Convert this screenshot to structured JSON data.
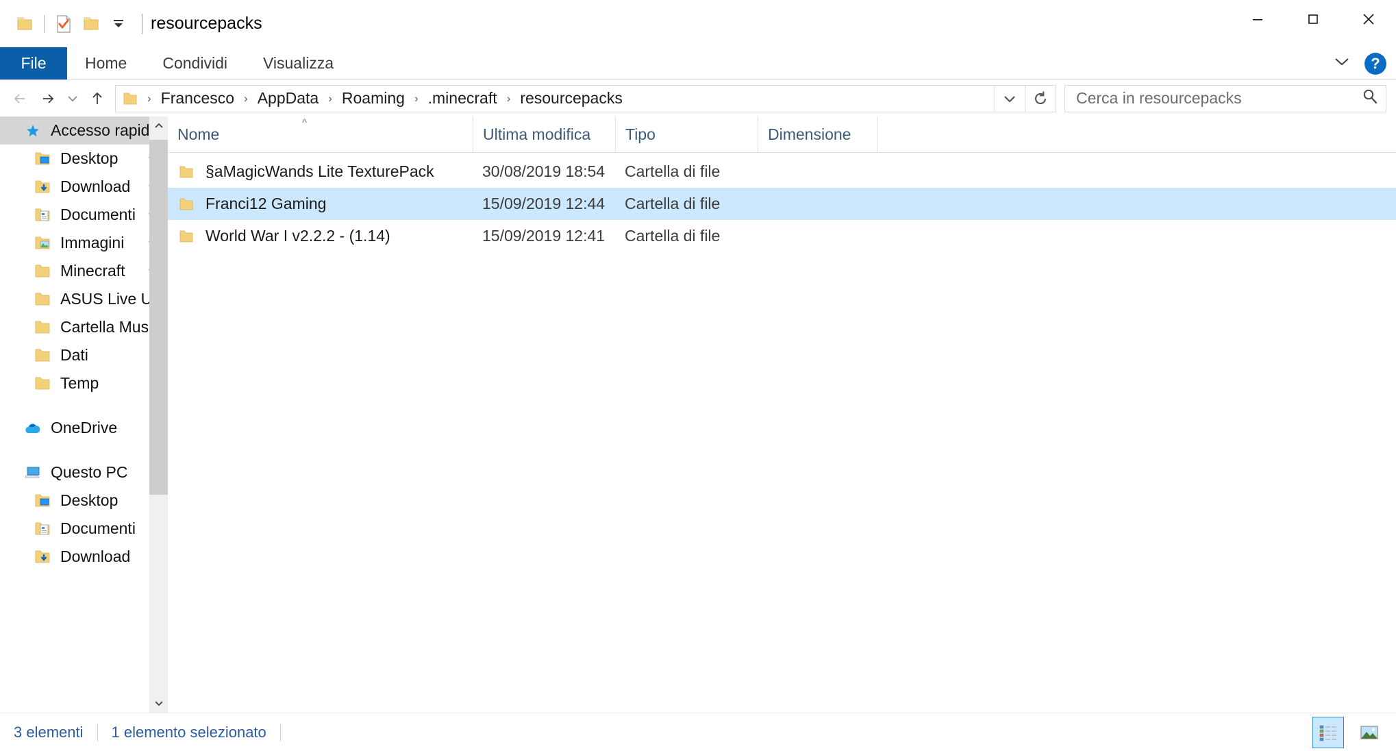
{
  "window": {
    "title": "resourcepacks",
    "quick_access_toolbar": [
      {
        "name": "folder-icon",
        "label": "Cartella"
      },
      {
        "name": "properties-icon",
        "label": "Proprietà"
      },
      {
        "name": "new-folder-icon",
        "label": "Nuova cartella"
      },
      {
        "name": "customize-dropdown-icon",
        "label": "Personalizza barra di accesso rapido"
      }
    ],
    "controls": {
      "minimize": "Riduci a icona",
      "maximize": "Ingrandisci",
      "close": "Chiudi"
    }
  },
  "ribbon": {
    "tabs": [
      {
        "label": "File",
        "active": true
      },
      {
        "label": "Home",
        "active": false
      },
      {
        "label": "Condividi",
        "active": false
      },
      {
        "label": "Visualizza",
        "active": false
      }
    ],
    "expand_label": "Espandi barra multifunzione",
    "help_label": "?"
  },
  "addressbar": {
    "back": "Indietro",
    "forward": "Avanti",
    "recent": "Percorsi recenti",
    "up": "Su",
    "breadcrumbs": [
      "Francesco",
      "AppData",
      "Roaming",
      ".minecraft",
      "resourcepacks"
    ],
    "separator": "›",
    "dropdown": "Elenco percorsi",
    "refresh": "Aggiorna"
  },
  "search": {
    "placeholder": "Cerca in resourcepacks",
    "value": "",
    "icon": "search-icon"
  },
  "sidebar": {
    "groups": [
      {
        "header": {
          "label": "Accesso rapido",
          "icon": "pin-star-icon",
          "selected": true
        },
        "items": [
          {
            "label": "Desktop",
            "icon": "folder-desktop-icon",
            "pinned": true
          },
          {
            "label": "Download",
            "icon": "folder-download-icon",
            "pinned": true
          },
          {
            "label": "Documenti",
            "icon": "folder-documents-icon",
            "pinned": true
          },
          {
            "label": "Immagini",
            "icon": "folder-pictures-icon",
            "pinned": true
          },
          {
            "label": "Minecraft",
            "icon": "folder-icon",
            "pinned": true
          },
          {
            "label": "ASUS Live Updat",
            "icon": "folder-icon",
            "pinned": false
          },
          {
            "label": "Cartella Musica",
            "icon": "folder-icon",
            "pinned": false
          },
          {
            "label": "Dati",
            "icon": "folder-icon",
            "pinned": false
          },
          {
            "label": "Temp",
            "icon": "folder-icon",
            "pinned": false
          }
        ]
      },
      {
        "header": {
          "label": "OneDrive",
          "icon": "onedrive-cloud-icon",
          "selected": false
        },
        "items": []
      },
      {
        "header": {
          "label": "Questo PC",
          "icon": "this-pc-icon",
          "selected": false
        },
        "items": [
          {
            "label": "Desktop",
            "icon": "folder-desktop-icon",
            "pinned": false
          },
          {
            "label": "Documenti",
            "icon": "folder-documents-icon",
            "pinned": false
          },
          {
            "label": "Download",
            "icon": "folder-download-icon",
            "pinned": false
          }
        ]
      }
    ]
  },
  "filelist": {
    "columns": [
      {
        "label": "Nome",
        "sorted": true,
        "sort_direction": "asc"
      },
      {
        "label": "Ultima modifica",
        "sorted": false
      },
      {
        "label": "Tipo",
        "sorted": false
      },
      {
        "label": "Dimensione",
        "sorted": false
      }
    ],
    "sort_glyph": "^",
    "rows": [
      {
        "name": "§aMagicWands Lite TexturePack",
        "modified": "30/08/2019 18:54",
        "type": "Cartella di file",
        "size": "",
        "icon": "folder-icon",
        "selected": false
      },
      {
        "name": "Franci12 Gaming",
        "modified": "15/09/2019 12:44",
        "type": "Cartella di file",
        "size": "",
        "icon": "folder-icon",
        "selected": true
      },
      {
        "name": "World War I v2.2.2 - (1.14)",
        "modified": "15/09/2019 12:41",
        "type": "Cartella di file",
        "size": "",
        "icon": "folder-icon",
        "selected": false
      }
    ]
  },
  "statusbar": {
    "item_count": "3 elementi",
    "selection_count": "1 elemento selezionato",
    "views": [
      {
        "name": "details-view-icon",
        "label": "Visualizza dettagli",
        "active": true
      },
      {
        "name": "large-icons-view-icon",
        "label": "Visualizza icone grandi",
        "active": false
      }
    ]
  },
  "colors": {
    "accent": "#0b5ea8",
    "selection": "#cce8ff",
    "folder": "#f7d074",
    "link_text": "#2b5ba1"
  }
}
